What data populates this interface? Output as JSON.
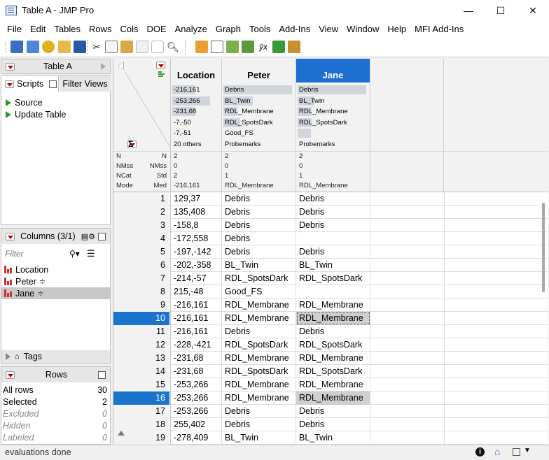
{
  "window": {
    "title": "Table A - JMP Pro",
    "minimize": "—",
    "maximize": "☐",
    "close": "✕"
  },
  "menu": [
    "File",
    "Edit",
    "Tables",
    "Rows",
    "Cols",
    "DOE",
    "Analyze",
    "Graph",
    "Tools",
    "Add-Ins",
    "View",
    "Window",
    "Help",
    "MFI Add-Ins"
  ],
  "table_panel": {
    "title": "Table A"
  },
  "scripts_panel": {
    "tab_scripts": "Scripts",
    "tab_filter": "Filter Views",
    "items": [
      "Source",
      "Update Table"
    ]
  },
  "columns_panel": {
    "title": "Columns (3/1)",
    "filter_placeholder": "Filter",
    "items": [
      {
        "name": "Location",
        "selected": false
      },
      {
        "name": "Peter",
        "selected": false
      },
      {
        "name": "Jane",
        "selected": true
      }
    ],
    "tags_label": "Tags"
  },
  "rows_panel": {
    "title": "Rows",
    "items": [
      {
        "label": "All rows",
        "value": "30",
        "italic": false
      },
      {
        "label": "Selected",
        "value": "2",
        "italic": false
      },
      {
        "label": "Excluded",
        "value": "0",
        "italic": true
      },
      {
        "label": "Hidden",
        "value": "0",
        "italic": true
      },
      {
        "label": "Labeled",
        "value": "0",
        "italic": true
      }
    ]
  },
  "grid": {
    "sigma": "Σ",
    "columns": [
      "Location",
      "Peter",
      "Jane"
    ],
    "selected_column": "Jane",
    "histograms": {
      "Location": [
        {
          "label": "-216,161",
          "fill": 0.5
        },
        {
          "label": "-253,266",
          "fill": 0.83
        },
        {
          "label": "-231,68",
          "fill": 0.5
        },
        {
          "label": "-7,-50",
          "fill": 0
        },
        {
          "label": "-7,-51",
          "fill": 0
        },
        {
          "label": "20 others",
          "fill": 0
        }
      ],
      "Peter": [
        {
          "label": "Debris",
          "fill": 1.0
        },
        {
          "label": "BL_Twin",
          "fill": 0.43
        },
        {
          "label": "RDL_Membrane",
          "fill": 0.2
        },
        {
          "label": "RDL_SpotsDark",
          "fill": 0.24
        },
        {
          "label": "Good_FS",
          "fill": 0
        },
        {
          "label": "Probemarks",
          "fill": 0
        }
      ],
      "Jane": [
        {
          "label": "Debris",
          "fill": 1.0
        },
        {
          "label": "BL_Twin",
          "fill": 0.24
        },
        {
          "label": "RDL_Membrane",
          "fill": 0.2
        },
        {
          "label": "RDL_SpotsDark",
          "fill": 0.2
        },
        {
          "label": "",
          "fill": 0.19
        },
        {
          "label": "Probemarks",
          "fill": 0
        }
      ]
    },
    "summary_left": [
      "N",
      "NMss",
      "NCat",
      "Mode"
    ],
    "summary_right": [
      "N",
      "NMss",
      "Std",
      "Med"
    ],
    "summary": {
      "Location": [
        "2",
        "0",
        "2",
        "-216,161"
      ],
      "Peter": [
        "2",
        "0",
        "1",
        "RDL_Membrane"
      ],
      "Jane": [
        "2",
        "0",
        "1",
        "RDL_Membrane"
      ]
    },
    "rows": [
      {
        "n": "1",
        "loc": "129,37",
        "peter": "Debris",
        "jane": "Debris"
      },
      {
        "n": "2",
        "loc": "135,408",
        "peter": "Debris",
        "jane": "Debris"
      },
      {
        "n": "3",
        "loc": "-158,8",
        "peter": "Debris",
        "jane": "Debris"
      },
      {
        "n": "4",
        "loc": "-172,558",
        "peter": "Debris",
        "jane": ""
      },
      {
        "n": "5",
        "loc": "-197,-142",
        "peter": "Debris",
        "jane": "Debris"
      },
      {
        "n": "6",
        "loc": "-202,-358",
        "peter": "BL_Twin",
        "jane": "BL_Twin"
      },
      {
        "n": "7",
        "loc": "-214,-57",
        "peter": "RDL_SpotsDark",
        "jane": "RDL_SpotsDark"
      },
      {
        "n": "8",
        "loc": "215,-48",
        "peter": "Good_FS",
        "jane": ""
      },
      {
        "n": "9",
        "loc": "-216,161",
        "peter": "RDL_Membrane",
        "jane": "RDL_Membrane"
      },
      {
        "n": "10",
        "loc": "-216,161",
        "peter": "RDL_Membrane",
        "jane": "RDL_Membrane",
        "selected": true,
        "focus": true
      },
      {
        "n": "11",
        "loc": "-216,161",
        "peter": "Debris",
        "jane": "Debris"
      },
      {
        "n": "12",
        "loc": "-228,-421",
        "peter": "RDL_SpotsDark",
        "jane": "RDL_SpotsDark"
      },
      {
        "n": "13",
        "loc": "-231,68",
        "peter": "RDL_Membrane",
        "jane": "RDL_Membrane"
      },
      {
        "n": "14",
        "loc": "-231,68",
        "peter": "RDL_SpotsDark",
        "jane": "RDL_SpotsDark"
      },
      {
        "n": "15",
        "loc": "-253,266",
        "peter": "RDL_Membrane",
        "jane": "RDL_Membrane"
      },
      {
        "n": "16",
        "loc": "-253,266",
        "peter": "RDL_Membrane",
        "jane": "RDL_Membrane",
        "selected": true
      },
      {
        "n": "17",
        "loc": "-253,266",
        "peter": "Debris",
        "jane": "Debris"
      },
      {
        "n": "18",
        "loc": "255,402",
        "peter": "Debris",
        "jane": "Debris"
      },
      {
        "n": "19",
        "loc": "-278,409",
        "peter": "BL_Twin",
        "jane": "BL_Twin"
      }
    ]
  },
  "status": {
    "text": "evaluations done"
  },
  "colors": {
    "selection_blue": "#1a73cc",
    "selected_cell_gray": "#cfcfcf",
    "header_blue": "#1e6fd0",
    "red_icon": "#c00000",
    "green_icon": "#2a9a2a"
  }
}
